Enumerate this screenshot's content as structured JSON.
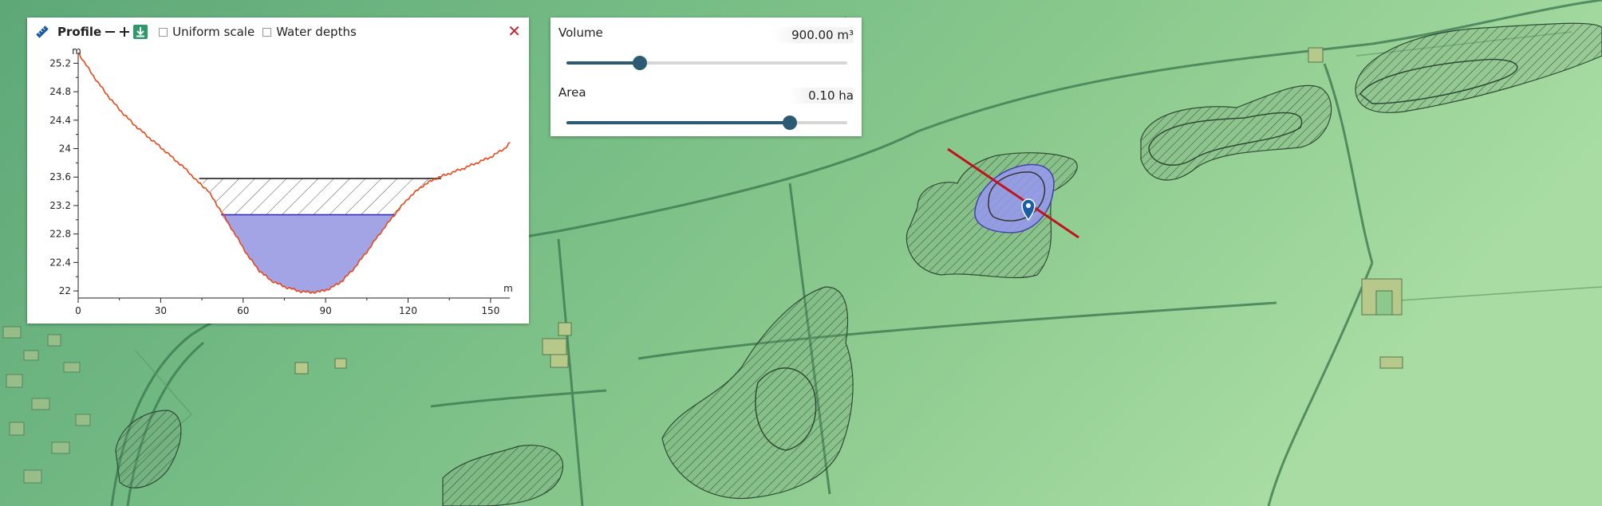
{
  "profile": {
    "title": "Profile",
    "ruler_icon": "ruler-icon",
    "zoom_out_icon": "minus-icon",
    "zoom_in_icon": "plus-icon",
    "download_icon": "download-icon",
    "uniform_scale_label": "Uniform scale",
    "uniform_scale_checked": false,
    "water_depths_label": "Water depths",
    "water_depths_checked": false,
    "close_icon": "close-icon",
    "close_symbol": "✕",
    "download_color": "#2e9a6a",
    "close_color": "#c0272d"
  },
  "sliders": {
    "volume": {
      "label": "Volume",
      "value": "900.00 m³",
      "fraction": 0.26
    },
    "area": {
      "label": "Area",
      "value": "0.10 ha",
      "fraction": 0.795
    },
    "accent_color": "#2b5a72"
  },
  "chart_data": {
    "type": "area",
    "xlabel": "m",
    "ylabel": "m",
    "x_ticks": [
      "0",
      "30",
      "60",
      "90",
      "120",
      "150"
    ],
    "y_ticks": [
      "22",
      "22.4",
      "22.8",
      "23.2",
      "23.6",
      "24",
      "24.4",
      "24.8",
      "25.2"
    ],
    "xlim": [
      0,
      157
    ],
    "ylim": [
      21.9,
      25.35
    ],
    "grid": false,
    "terrain_color": "#e8471b",
    "water_color": "#a3a4e6",
    "water_line_color": "#2222cc",
    "terrain_profile": [
      [
        0,
        25.35
      ],
      [
        5,
        25.05
      ],
      [
        10,
        24.78
      ],
      [
        15,
        24.55
      ],
      [
        20,
        24.35
      ],
      [
        25,
        24.18
      ],
      [
        30,
        24.02
      ],
      [
        35,
        23.85
      ],
      [
        40,
        23.68
      ],
      [
        43,
        23.55
      ],
      [
        47,
        23.42
      ],
      [
        52,
        23.12
      ],
      [
        57,
        22.8
      ],
      [
        62,
        22.48
      ],
      [
        66,
        22.28
      ],
      [
        70,
        22.15
      ],
      [
        75,
        22.06
      ],
      [
        80,
        22.0
      ],
      [
        84,
        21.98
      ],
      [
        88,
        21.99
      ],
      [
        92,
        22.04
      ],
      [
        96,
        22.14
      ],
      [
        100,
        22.3
      ],
      [
        105,
        22.55
      ],
      [
        110,
        22.82
      ],
      [
        115,
        23.07
      ],
      [
        120,
        23.3
      ],
      [
        125,
        23.47
      ],
      [
        130,
        23.58
      ],
      [
        135,
        23.65
      ],
      [
        140,
        23.72
      ],
      [
        145,
        23.8
      ],
      [
        150,
        23.88
      ],
      [
        155,
        24.0
      ],
      [
        157,
        24.08
      ]
    ],
    "max_level": 23.58,
    "max_level_extent": [
      44,
      132
    ],
    "water_level": 23.07,
    "water_level_extent": [
      52,
      115
    ]
  }
}
